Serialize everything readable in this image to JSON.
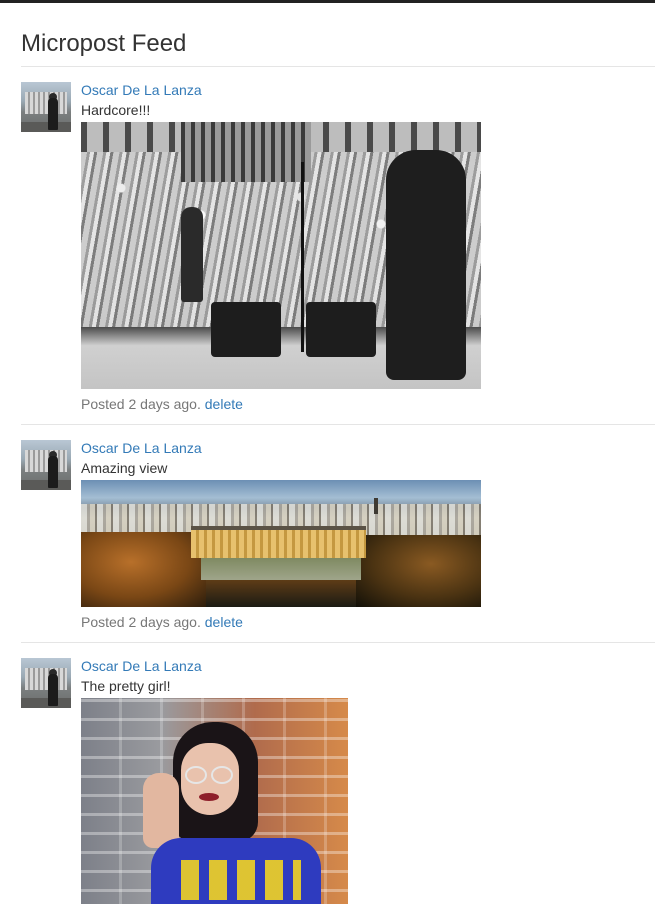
{
  "feed": {
    "title": "Micropost Feed"
  },
  "posts": [
    {
      "user": "Oscar De La Lanza",
      "content": "Hardcore!!!",
      "image_subject": "black-and-white concert stage with guitarist and crowd",
      "timestamp_prefix": "Posted 2 days ago.",
      "delete_label": "delete"
    },
    {
      "user": "Oscar De La Lanza",
      "content": "Amazing view",
      "image_subject": "city panorama with palace and autumn trees",
      "timestamp_prefix": "Posted 2 days ago.",
      "delete_label": "delete"
    },
    {
      "user": "Oscar De La Lanza",
      "content": "The pretty girl!",
      "image_subject": "woman with glasses against brick wall",
      "timestamp_prefix": "",
      "delete_label": ""
    }
  ],
  "colors": {
    "link": "#337ab7",
    "text": "#333333",
    "muted": "#777777",
    "divider": "#e5e5e5",
    "topbar": "#222222"
  }
}
